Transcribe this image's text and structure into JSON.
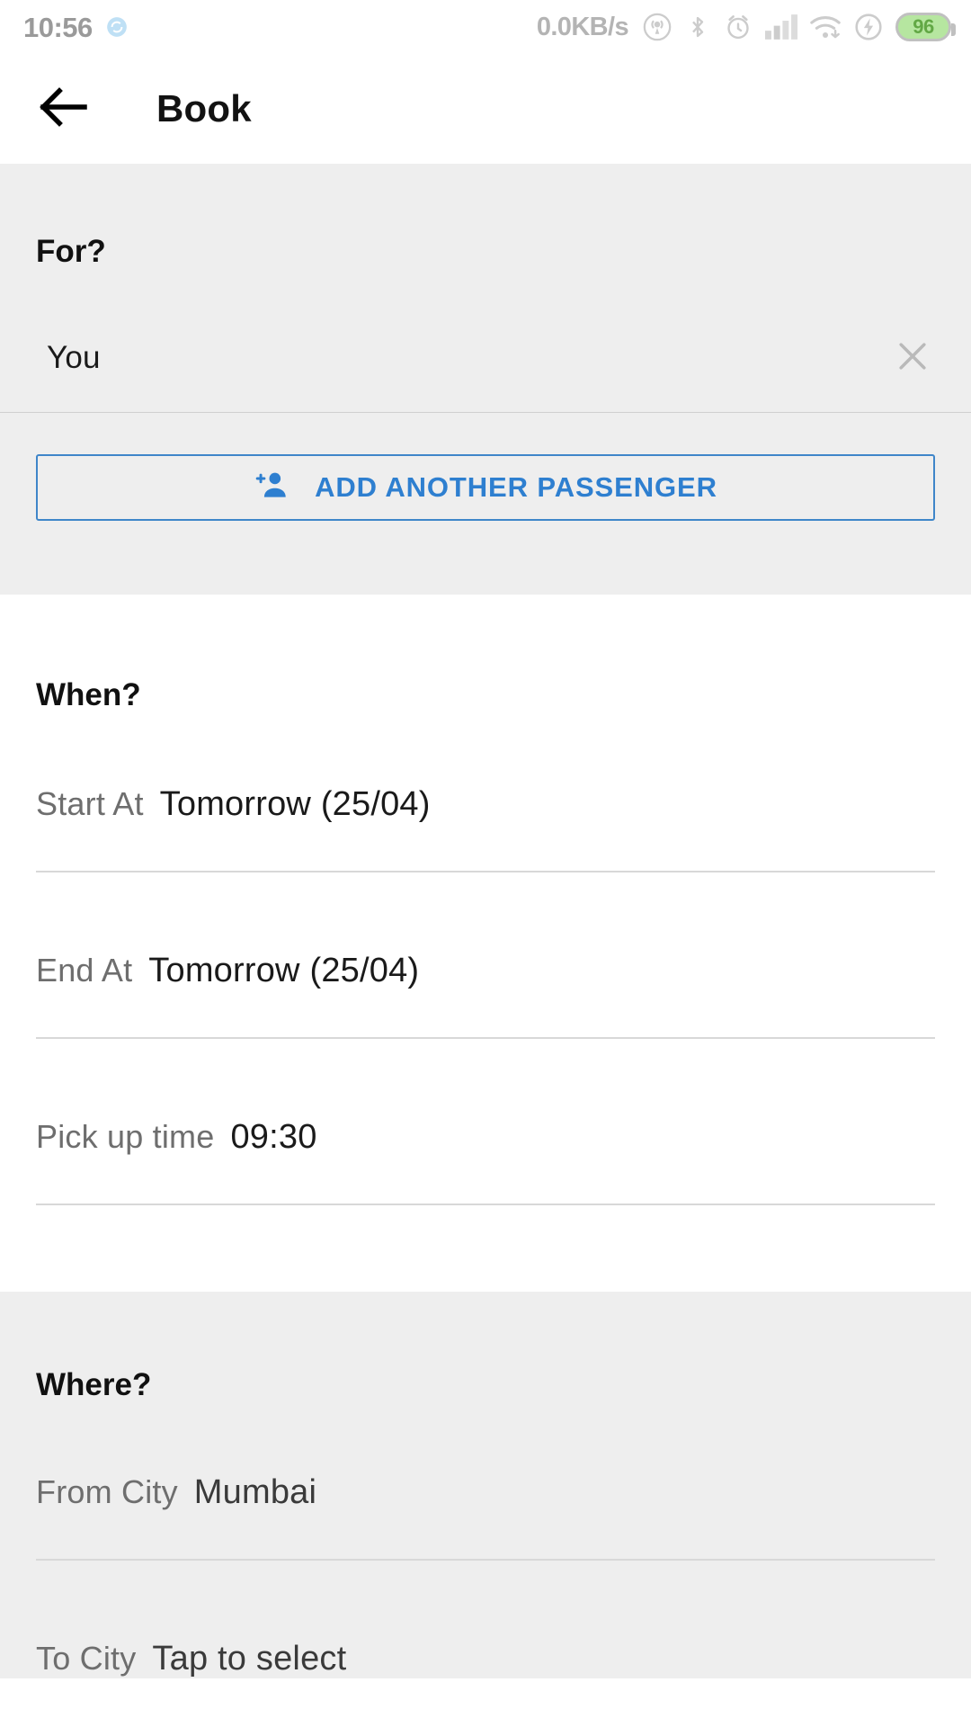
{
  "statusbar": {
    "time": "10:56",
    "sync_icon": "sync-icon",
    "network_speed": "0.0KB/s",
    "icons": [
      "hotspot-icon",
      "bluetooth-icon",
      "alarm-icon",
      "signal-icon",
      "wifi-icon",
      "charging-icon"
    ],
    "battery_level": "96"
  },
  "appbar": {
    "back_icon": "back-arrow-icon",
    "title": "Book"
  },
  "for_section": {
    "title": "For?",
    "passenger": "You",
    "remove_icon": "close-icon",
    "add_button": {
      "icon": "person-add-icon",
      "label": "ADD ANOTHER PASSENGER"
    }
  },
  "when_section": {
    "title": "When?",
    "fields": [
      {
        "label": "Start At",
        "value": "Tomorrow (25/04)"
      },
      {
        "label": "End At",
        "value": "Tomorrow (25/04)"
      },
      {
        "label": "Pick up time",
        "value": "09:30"
      }
    ]
  },
  "where_section": {
    "title": "Where?",
    "fields": [
      {
        "label": "From City",
        "value": "Mumbai"
      },
      {
        "label": "To City",
        "value": "Tap to select"
      }
    ]
  },
  "colors": {
    "accent_blue": "#2e7fd0",
    "section_gray": "#eeeeee",
    "label_gray": "#6e6e6e",
    "battery_green": "#b6e6a0"
  }
}
